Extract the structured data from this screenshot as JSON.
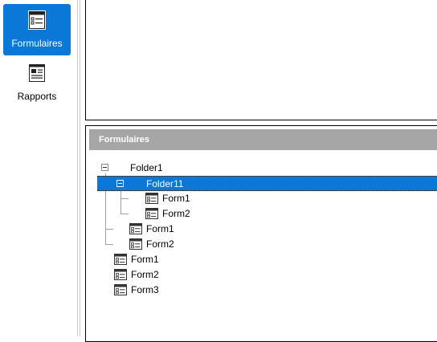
{
  "sidebar": {
    "items": [
      {
        "label": "Formulaires",
        "icon": "forms-icon",
        "active": true
      },
      {
        "label": "Rapports",
        "icon": "report-icon",
        "active": false
      }
    ]
  },
  "section": {
    "title": "Formulaires"
  },
  "tree": {
    "folder1": "Folder1",
    "folder11": "Folder11",
    "folder11_form1": "Form1",
    "folder11_form2": "Form2",
    "folder1_form1": "Form1",
    "folder1_form2": "Form2",
    "root_form1": "Form1",
    "root_form2": "Form2",
    "root_form3": "Form3"
  },
  "colors": {
    "accent": "#0b78d7",
    "section_header": "#a6a6a6"
  }
}
